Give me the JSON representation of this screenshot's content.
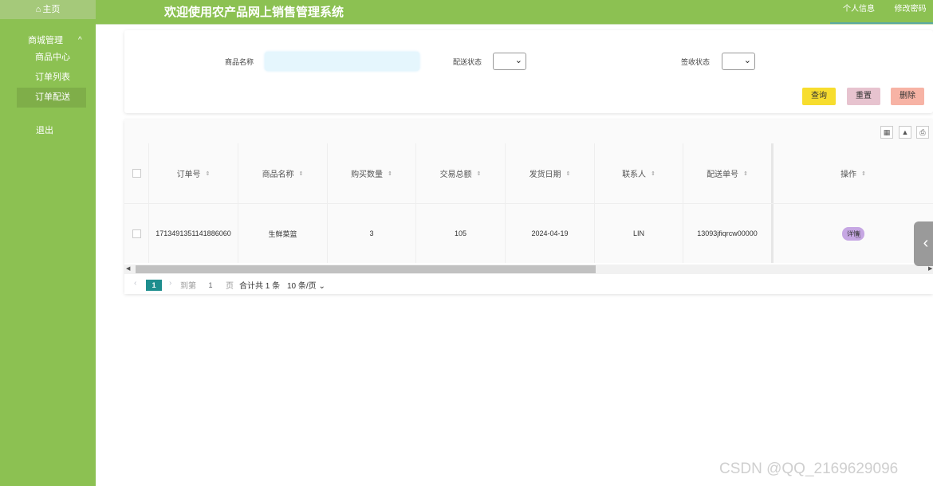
{
  "sidebar": {
    "home": "主页",
    "group": "商城管理",
    "items": [
      {
        "label": "商品中心"
      },
      {
        "label": "订单列表"
      },
      {
        "label": "订单配送"
      }
    ],
    "logout": "退出"
  },
  "header": {
    "title": "欢迎使用农产品网上销售管理系统",
    "personal": "个人信息",
    "password": "修改密码"
  },
  "search": {
    "name_label": "商品名称",
    "name_value": "",
    "ship_label": "配送状态",
    "sign_label": "签收状态",
    "query": "查询",
    "reset": "重置",
    "delete": "删除"
  },
  "table": {
    "columns": [
      "订单号",
      "商品名称",
      "购买数量",
      "交易总额",
      "发货日期",
      "联系人",
      "配送单号",
      "操作"
    ],
    "rows": [
      {
        "order_no": "1713491351141886060",
        "product": "生鲜菜篮",
        "quantity": "3",
        "total": "105",
        "ship_date": "2024-04-19",
        "contact": "LIN",
        "tracking": "13093jfiqrcw00000",
        "action": "详情"
      }
    ]
  },
  "pager": {
    "current": "1",
    "goto": "到第",
    "page_input": "1",
    "page_unit": "页",
    "total": "合计共 1 条",
    "size": "10 条/页"
  },
  "watermark": "CSDN @QQ_2169629096",
  "colors": {
    "sidebar": "#8cc152",
    "accent": "#1e8e8e",
    "query": "#f7dd2e",
    "reset": "#e7c3cf",
    "delete": "#f7b3a5"
  }
}
